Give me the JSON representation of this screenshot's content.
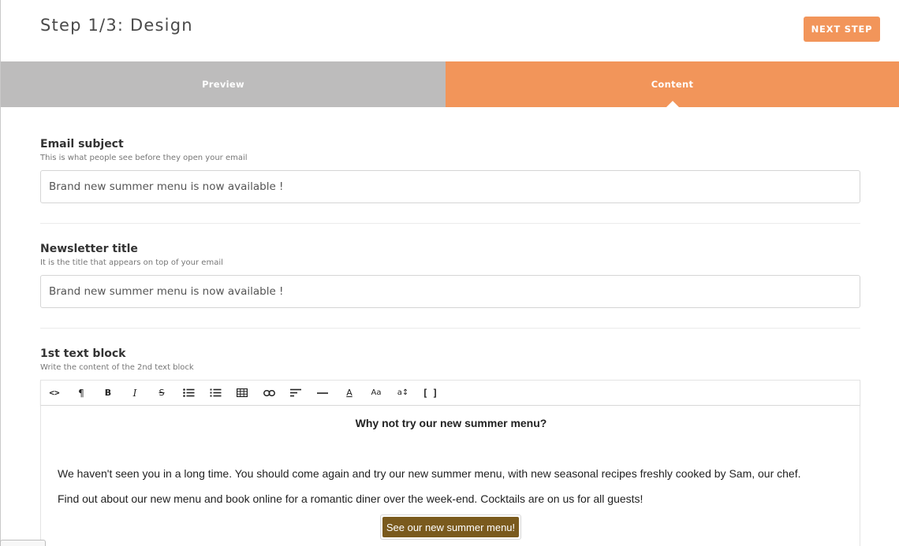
{
  "header": {
    "title": "Step 1/3: Design",
    "next_label": "NEXT STEP"
  },
  "tabs": [
    {
      "label": "Preview",
      "active": false
    },
    {
      "label": "Content",
      "active": true
    }
  ],
  "fields": {
    "subject": {
      "label": "Email subject",
      "help": "This is what people see before they open your email",
      "value": "Brand new summer menu is now available !"
    },
    "newsletter_title": {
      "label": "Newsletter title",
      "help": "It is the title that appears on top of your email",
      "value": "Brand new summer menu is now available !"
    },
    "text_block": {
      "label": "1st text block",
      "help": "Write the content of the 2nd text block"
    }
  },
  "toolbar": {
    "items": [
      "html-icon",
      "paragraph-icon",
      "bold-icon",
      "italic-icon",
      "strikethrough-icon",
      "unordered-list-icon",
      "ordered-list-icon",
      "table-icon",
      "link-icon",
      "align-icon",
      "horizontal-rule-icon",
      "font-color-icon",
      "font-size-icon",
      "line-height-icon",
      "fullscreen-icon"
    ],
    "glyphs": {
      "html": "<>",
      "paragraph": "¶",
      "bold": "B",
      "italic": "I",
      "strike": "S",
      "font_color": "A",
      "font_size": "Aa",
      "line_height": "a↕",
      "fullscreen": "[ ]"
    }
  },
  "editor": {
    "heading": "Why not try our new summer menu?",
    "paragraphs": [
      "We haven't seen you in a long time. You should come again and try our new summer menu, with new seasonal recipes freshly cooked by Sam, our chef.",
      "Find out about our new menu and book online for a romantic diner over the week-end. Cocktails are on us for all guests!"
    ],
    "button_label": "See our new summer menu!"
  },
  "colors": {
    "accent": "#f2955a",
    "inactive_tab": "#bdbcbc",
    "cta_button": "#7a5a1d"
  }
}
